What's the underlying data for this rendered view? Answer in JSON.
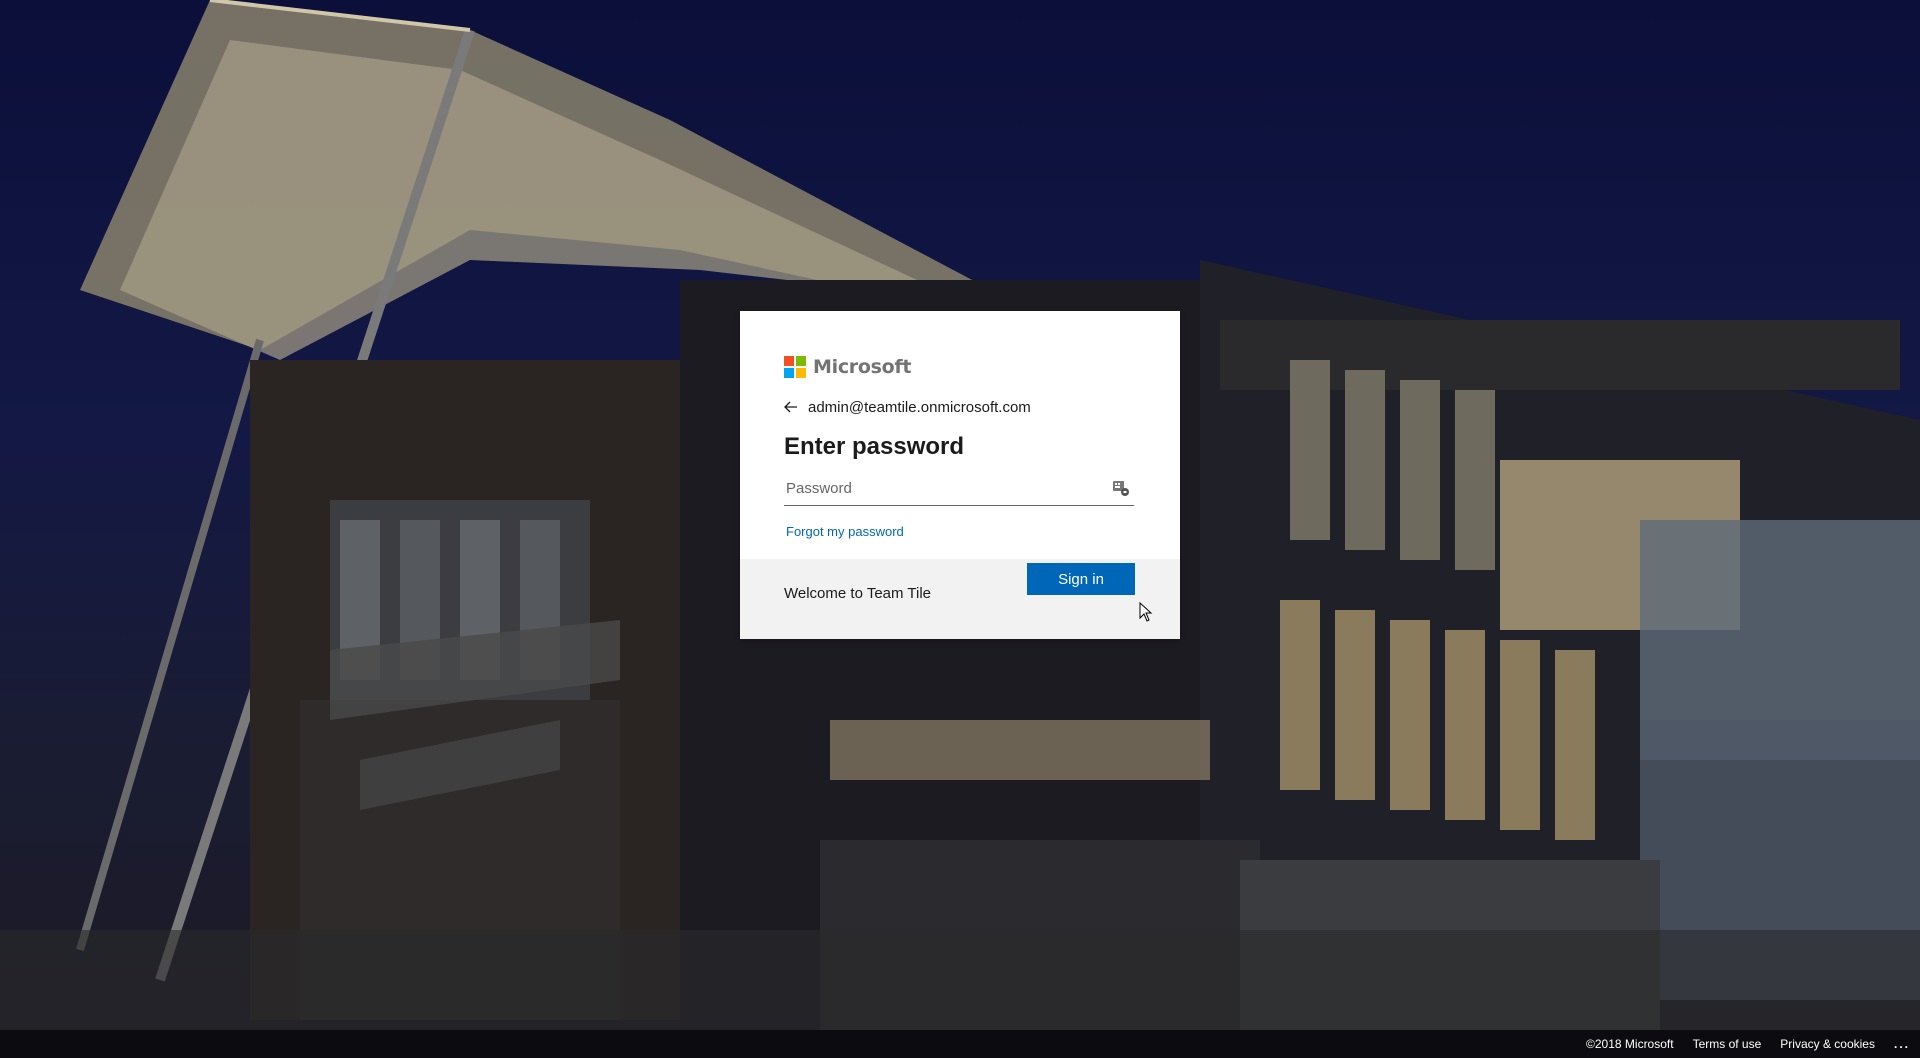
{
  "brand": {
    "name": "Microsoft",
    "logo_colors": [
      "#f25022",
      "#7fba00",
      "#00a4ef",
      "#ffb900"
    ]
  },
  "identity": {
    "back_icon": "arrow-left-icon",
    "email": "admin@teamtile.onmicrosoft.com"
  },
  "form": {
    "title": "Enter password",
    "password_placeholder": "Password",
    "password_value": "",
    "key_icon": "password-key-icon",
    "forgot_link": "Forgot my password",
    "signin_label": "Sign in"
  },
  "banner": {
    "text": "Welcome to Team Tile"
  },
  "footer": {
    "copyright": "©2018 Microsoft",
    "terms": "Terms of use",
    "privacy": "Privacy & cookies",
    "more": "..."
  },
  "colors": {
    "accent": "#0067b8",
    "card_bg": "#ffffff",
    "banner_bg": "#f2f2f2"
  }
}
